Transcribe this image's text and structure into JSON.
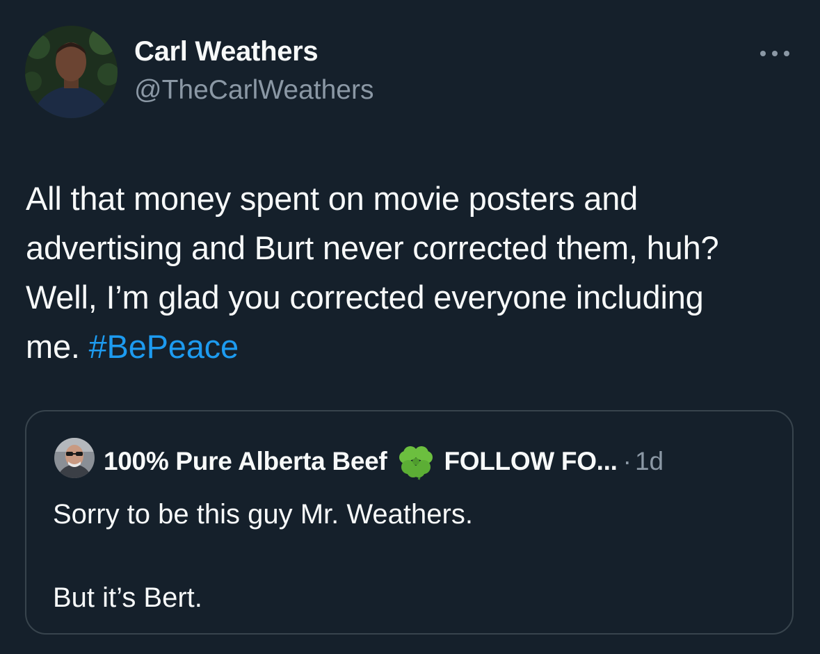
{
  "tweet": {
    "author": {
      "name": "Carl Weathers",
      "handle": "@TheCarlWeathers"
    },
    "text": {
      "line1": "All that money spent on movie posters and",
      "line2": "advertising and Burt never corrected them, huh?",
      "line3": "Well, I’m glad you corrected everyone including",
      "line4_prefix": "me. ",
      "hashtag": "#BePeace"
    },
    "more_icon": "more-horizontal-icon"
  },
  "quoted_tweet": {
    "author_name_part1": "100% Pure Alberta Beef",
    "emoji_icon": "four-leaf-clover-icon",
    "author_name_part2": "FOLLOW FO...",
    "separator": "·",
    "time": "1d",
    "text": {
      "line1": "Sorry to be this guy Mr. Weathers.",
      "line2": "",
      "line3": "But it’s Bert."
    }
  },
  "colors": {
    "background": "#15202b",
    "text_primary": "#f7f9f9",
    "text_secondary": "#8b98a5",
    "link": "#1d9bf0",
    "border": "#38444d"
  }
}
